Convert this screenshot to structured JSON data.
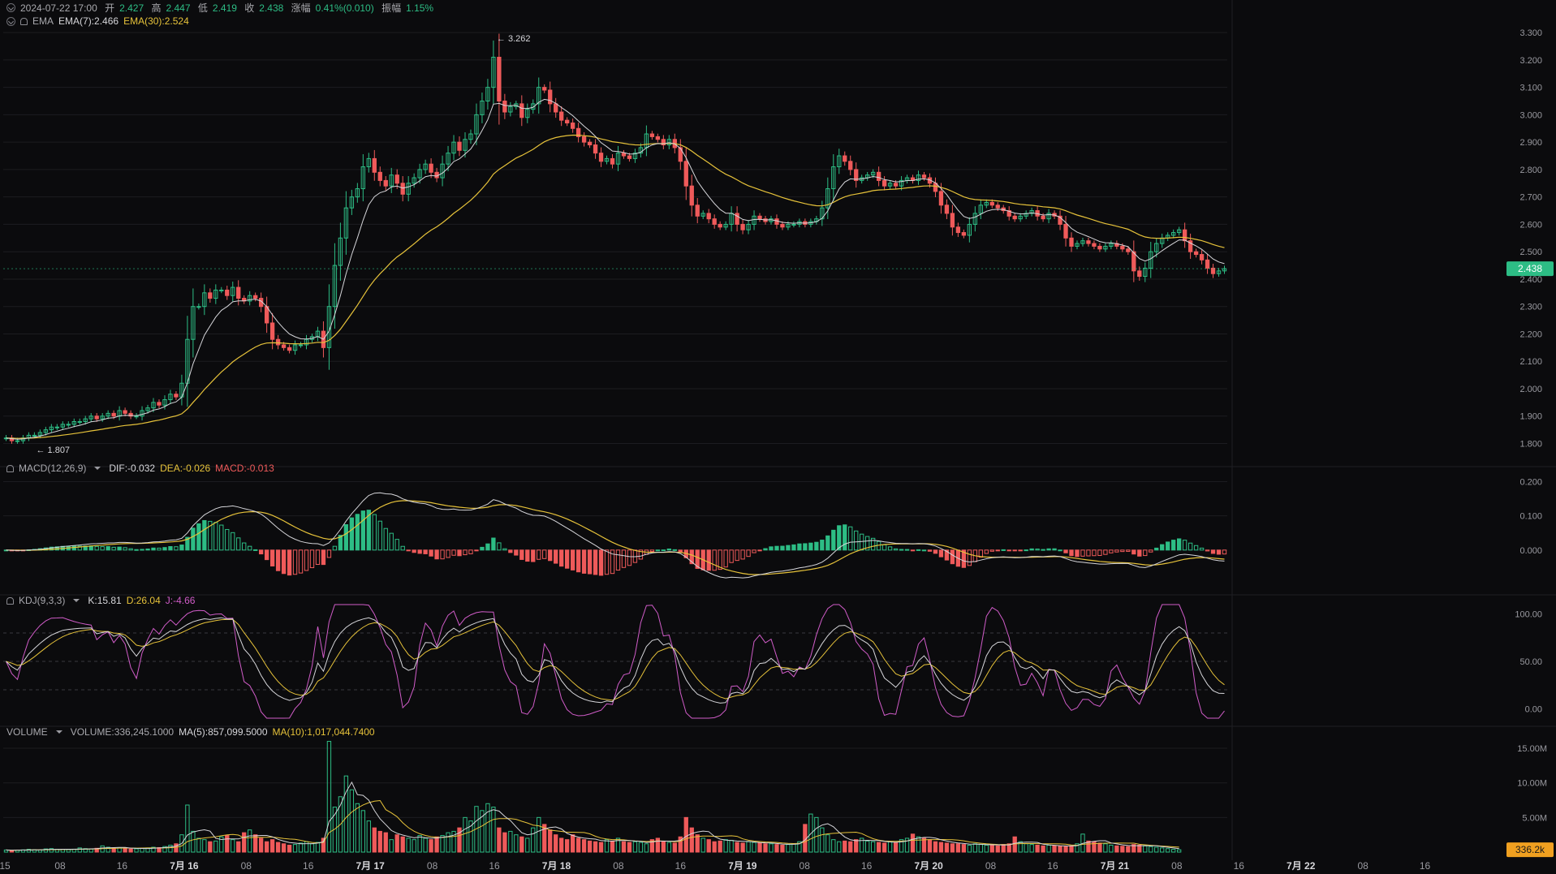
{
  "header": {
    "datetime": "2024-07-22 17:00",
    "open_label": "开",
    "open": "2.427",
    "high_label": "高",
    "high": "2.447",
    "low_label": "低",
    "low": "2.419",
    "close_label": "收",
    "close": "2.438",
    "change_label": "涨幅",
    "change": "0.41%(0.010)",
    "amplitude_label": "振幅",
    "amplitude": "1.15%"
  },
  "indicators": {
    "ema": {
      "name": "EMA",
      "ema7": "EMA(7):2.466",
      "ema30": "EMA(30):2.524"
    },
    "macd": {
      "name": "MACD(12,26,9)",
      "dif": "DIF:-0.032",
      "dea": "DEA:-0.026",
      "macd": "MACD:-0.013"
    },
    "kdj": {
      "name": "KDJ(9,3,3)",
      "k": "K:15.81",
      "d": "D:26.04",
      "j": "J:-4.66"
    },
    "volume": {
      "name": "VOLUME",
      "vol": "VOLUME:336,245.1000",
      "ma5": "MA(5):857,099.5000",
      "ma10": "MA(10):1,017,044.7400"
    }
  },
  "colors": {
    "up": "#2dbd85",
    "down": "#ef5a5a",
    "ema7": "#d6d6da",
    "ema30": "#e6c23a",
    "j": "#d05cc8",
    "grid": "#1c1c20",
    "axis_text": "#9a9aa0",
    "background": "#0b0b0d"
  },
  "chart_data": [
    {
      "type": "candlestick",
      "title": "",
      "x_ticks": [
        "15",
        "08",
        "16",
        "7月 16",
        "08",
        "16",
        "7月 17",
        "08",
        "16",
        "7月 18",
        "08",
        "16",
        "7月 19",
        "08",
        "16",
        "7月 20",
        "08",
        "16",
        "7月 21",
        "08",
        "16",
        "7月 22",
        "08",
        "16"
      ],
      "y_ticks": [
        "3.300",
        "3.200",
        "3.100",
        "3.000",
        "2.900",
        "2.800",
        "2.700",
        "2.600",
        "2.500",
        "2.400",
        "2.300",
        "2.200",
        "2.100",
        "2.000",
        "1.900",
        "1.800"
      ],
      "ylim": [
        1.76,
        3.33
      ],
      "annotations": {
        "high": "3.262",
        "low": "1.807"
      },
      "last_price": "2.438",
      "series": [
        {
          "name": "EMA(7)",
          "color": "#d6d6da"
        },
        {
          "name": "EMA(30)",
          "color": "#e6c23a"
        }
      ],
      "close": [
        1.82,
        1.81,
        1.81,
        1.82,
        1.83,
        1.83,
        1.84,
        1.85,
        1.86,
        1.86,
        1.87,
        1.87,
        1.88,
        1.88,
        1.89,
        1.9,
        1.89,
        1.9,
        1.91,
        1.9,
        1.92,
        1.91,
        1.9,
        1.9,
        1.92,
        1.93,
        1.95,
        1.94,
        1.96,
        1.98,
        1.97,
        2.02,
        2.18,
        2.3,
        2.3,
        2.35,
        2.33,
        2.36,
        2.36,
        2.34,
        2.37,
        2.33,
        2.32,
        2.34,
        2.33,
        2.3,
        2.24,
        2.18,
        2.16,
        2.15,
        2.14,
        2.16,
        2.16,
        2.18,
        2.19,
        2.21,
        2.15,
        2.3,
        2.45,
        2.55,
        2.66,
        2.7,
        2.73,
        2.81,
        2.84,
        2.79,
        2.76,
        2.74,
        2.78,
        2.75,
        2.71,
        2.75,
        2.77,
        2.8,
        2.82,
        2.79,
        2.77,
        2.82,
        2.86,
        2.9,
        2.87,
        2.91,
        2.93,
        3.0,
        3.05,
        3.1,
        3.21,
        3.05,
        3.01,
        3.03,
        3.04,
        2.99,
        3.02,
        3.04,
        3.1,
        3.09,
        3.04,
        3.01,
        2.98,
        2.97,
        2.95,
        2.92,
        2.9,
        2.89,
        2.86,
        2.83,
        2.84,
        2.82,
        2.86,
        2.85,
        2.84,
        2.86,
        2.88,
        2.93,
        2.92,
        2.91,
        2.89,
        2.91,
        2.88,
        2.83,
        2.74,
        2.67,
        2.63,
        2.64,
        2.62,
        2.6,
        2.59,
        2.6,
        2.64,
        2.6,
        2.58,
        2.6,
        2.63,
        2.62,
        2.61,
        2.62,
        2.6,
        2.59,
        2.6,
        2.6,
        2.61,
        2.6,
        2.61,
        2.62,
        2.66,
        2.73,
        2.81,
        2.85,
        2.83,
        2.8,
        2.76,
        2.77,
        2.78,
        2.79,
        2.76,
        2.74,
        2.75,
        2.74,
        2.76,
        2.77,
        2.76,
        2.78,
        2.77,
        2.75,
        2.72,
        2.67,
        2.64,
        2.59,
        2.57,
        2.56,
        2.6,
        2.64,
        2.67,
        2.68,
        2.67,
        2.66,
        2.65,
        2.63,
        2.62,
        2.63,
        2.64,
        2.65,
        2.63,
        2.62,
        2.64,
        2.63,
        2.6,
        2.55,
        2.52,
        2.53,
        2.54,
        2.53,
        2.52,
        2.51,
        2.52,
        2.53,
        2.52,
        2.51,
        2.5,
        2.43,
        2.41,
        2.44,
        2.5,
        2.53,
        2.55,
        2.56,
        2.57,
        2.58,
        2.54,
        2.5,
        2.49,
        2.47,
        2.44,
        2.42,
        2.43,
        2.438
      ]
    },
    {
      "type": "bar",
      "title": "MACD(12,26,9)",
      "y_ticks": [
        "0.200",
        "0.100",
        "0.000"
      ],
      "ylim": [
        -0.1,
        0.22
      ],
      "series": [
        {
          "name": "DIF",
          "color": "#d6d6da"
        },
        {
          "name": "DEA",
          "color": "#e6c23a"
        },
        {
          "name": "MACD",
          "color": "#2dbd85"
        }
      ]
    },
    {
      "type": "line",
      "title": "KDJ(9,3,3)",
      "y_ticks": [
        "100.00",
        "50.00",
        "0.00"
      ],
      "ylim": [
        -10,
        110
      ],
      "series": [
        {
          "name": "K",
          "color": "#d6d6da"
        },
        {
          "name": "D",
          "color": "#e6c23a"
        },
        {
          "name": "J",
          "color": "#d05cc8"
        }
      ]
    },
    {
      "type": "bar",
      "title": "VOLUME",
      "y_ticks": [
        "15.00M",
        "10.00M",
        "5.00M"
      ],
      "ylim": [
        0,
        17000000
      ],
      "last_volume": "336.2k",
      "series": [
        {
          "name": "VOLUME"
        },
        {
          "name": "MA(5)",
          "color": "#d6d6da"
        },
        {
          "name": "MA(10)",
          "color": "#e6c23a"
        }
      ],
      "values_k": [
        300,
        250,
        280,
        320,
        400,
        350,
        300,
        450,
        500,
        400,
        380,
        350,
        420,
        600,
        500,
        450,
        550,
        900,
        700,
        600,
        650,
        500,
        450,
        480,
        550,
        600,
        700,
        650,
        800,
        1000,
        1200,
        2500,
        6800,
        3000,
        2000,
        1800,
        1500,
        1600,
        2200,
        2400,
        1800,
        1500,
        2800,
        3200,
        2500,
        2000,
        1500,
        1800,
        1400,
        1200,
        1000,
        1100,
        1300,
        1500,
        1200,
        1400,
        2000,
        16000,
        6500,
        8000,
        11000,
        9000,
        7000,
        6000,
        4500,
        3500,
        3000,
        2800,
        1800,
        2500,
        2200,
        2000,
        1800,
        2400,
        2000,
        1800,
        2200,
        2400,
        2800,
        3000,
        3500,
        5000,
        4500,
        6600,
        6000,
        7000,
        6500,
        3500,
        2800,
        3000,
        2500,
        2200,
        2000,
        3500,
        5000,
        4000,
        3200,
        2500,
        2000,
        1800,
        2500,
        2000,
        1800,
        1600,
        1500,
        1400,
        1800,
        1600,
        2000,
        1500,
        1400,
        1500,
        1400,
        1200,
        1800,
        2000,
        1500,
        1400,
        1300,
        2200,
        5000,
        3500,
        2500,
        2000,
        1800,
        1500,
        1600,
        1800,
        1700,
        1400,
        1300,
        1500,
        1400,
        1300,
        1200,
        1200,
        1100,
        1000,
        1100,
        1200,
        1500,
        4000,
        5500,
        5000,
        3500,
        2500,
        1800,
        1500,
        1600,
        1500,
        1800,
        2000,
        1600,
        1500,
        1400,
        1300,
        1500,
        1400,
        1800,
        2000,
        2600,
        2200,
        2000,
        1800,
        1500,
        1400,
        1300,
        1200,
        1200,
        1100,
        1000,
        1200,
        1100,
        1000,
        1000,
        900,
        1100,
        1200,
        2200,
        1500,
        1200,
        1100,
        1000,
        900,
        1000,
        900,
        850,
        800,
        900,
        1200,
        2600,
        1600,
        1500,
        1300,
        1200,
        1000,
        900,
        850,
        800,
        1100,
        1000,
        900,
        800,
        700,
        600,
        500,
        400,
        336
      ]
    }
  ]
}
